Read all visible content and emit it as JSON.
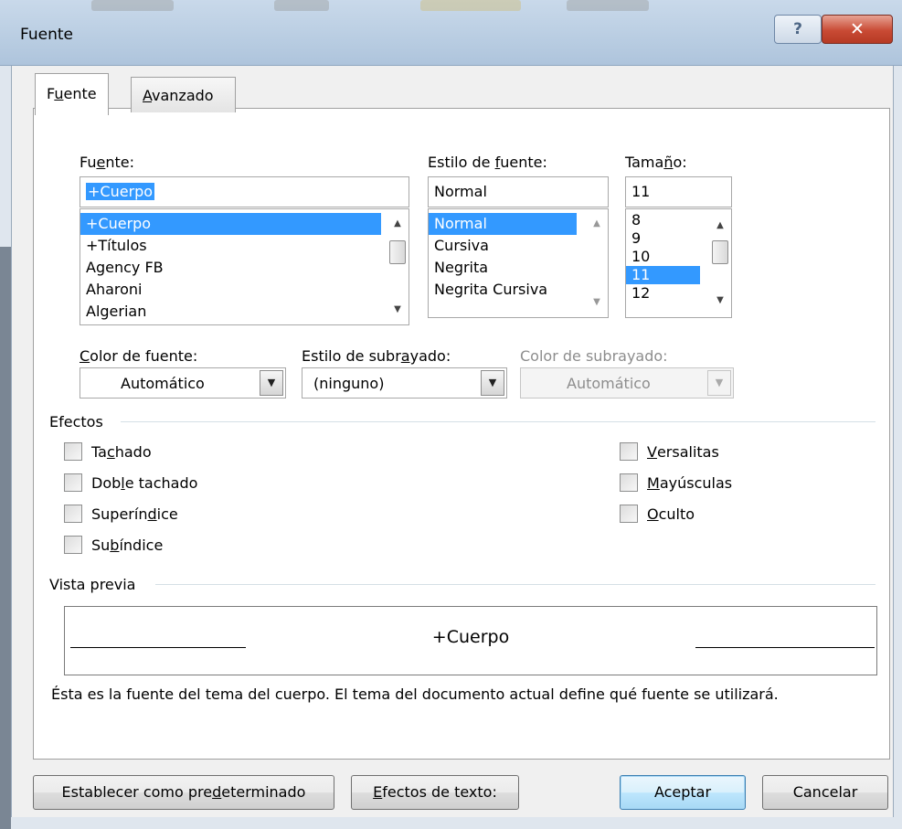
{
  "window": {
    "title": "Fuente",
    "help_glyph": "?",
    "close_glyph": "✕"
  },
  "tabs": [
    {
      "label": "Fuente",
      "accel_pre": "F",
      "accel": "u",
      "accel_post": "ente"
    },
    {
      "label": "Avanzado",
      "accel_pre": "",
      "accel": "A",
      "accel_post": "vanzado"
    }
  ],
  "font": {
    "label_pre": "Fu",
    "label_accel": "e",
    "label_post": "nte:",
    "value": "+Cuerpo",
    "items": [
      "+Cuerpo",
      "+Títulos",
      "Agency FB",
      "Aharoni",
      "Algerian"
    ],
    "selected_index": 0
  },
  "style": {
    "label_pre": "Estilo de ",
    "label_accel": "f",
    "label_post": "uente:",
    "value": "Normal",
    "items": [
      "Normal",
      "Cursiva",
      "Negrita",
      "Negrita Cursiva"
    ],
    "selected_index": 0
  },
  "size": {
    "label_pre": "Tama",
    "label_accel": "ñ",
    "label_post": "o:",
    "value": "11",
    "items": [
      "8",
      "9",
      "10",
      "11",
      "12"
    ],
    "selected_index": 3
  },
  "color": {
    "label_pre": "",
    "label_accel": "C",
    "label_post": "olor de fuente:",
    "value": "Automático"
  },
  "underline_style": {
    "label_pre": "Estilo de subr",
    "label_accel": "a",
    "label_post": "yado:",
    "value": "(ninguno)"
  },
  "underline_color": {
    "label": "Color de subrayado:",
    "value": "Automático"
  },
  "effects": {
    "title": "Efectos",
    "left": [
      {
        "pre": "Ta",
        "accel": "c",
        "post": "hado"
      },
      {
        "pre": "Dob",
        "accel": "l",
        "post": "e tachado"
      },
      {
        "pre": "Superín",
        "accel": "d",
        "post": "ice"
      },
      {
        "pre": "Su",
        "accel": "b",
        "post": "índice"
      }
    ],
    "right": [
      {
        "pre": "",
        "accel": "V",
        "post": "ersalitas"
      },
      {
        "pre": "",
        "accel": "M",
        "post": "ayúsculas"
      },
      {
        "pre": "",
        "accel": "O",
        "post": "culto"
      }
    ]
  },
  "preview": {
    "title": "Vista previa",
    "sample": "+Cuerpo",
    "description": "Ésta es la fuente del tema del cuerpo. El tema del documento actual define qué fuente se utilizará."
  },
  "buttons": {
    "set_default": {
      "pre": "Establecer como pre",
      "accel": "d",
      "post": "eterminado"
    },
    "text_effects": {
      "pre": "",
      "accel": "E",
      "post": "fectos de texto:"
    },
    "ok": "Aceptar",
    "cancel": "Cancelar"
  },
  "colors": {
    "selection": "#3399ff",
    "titlebar": "#b9cde2",
    "close": "#c94a34"
  }
}
